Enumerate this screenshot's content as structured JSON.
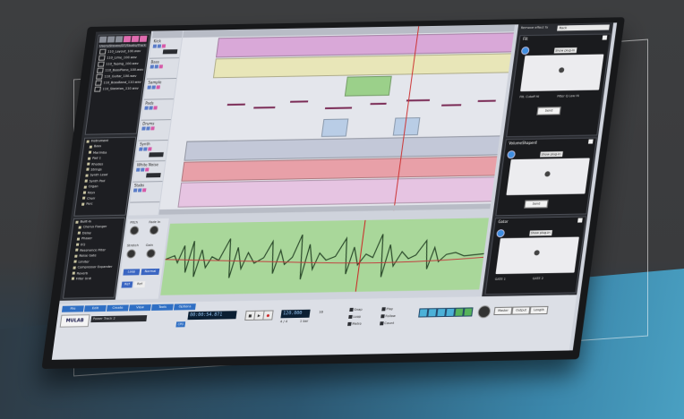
{
  "file_browser": {
    "path": "Users/Steven/DT/Studio/Track",
    "items": [
      "110_Layout_100.wav",
      "110_Lime_100.wav",
      "110_Typing_100.wav",
      "110_BassPiano_100.wav",
      "110_Guitar_100.wav",
      "110_BossBand_110.wav",
      "110_Skeleton_110.wav"
    ]
  },
  "instruments": {
    "header": "Instrument",
    "items": [
      "Bass",
      "Marimba",
      "Pad 1",
      "Rhodes",
      "Strings",
      "Synth Lead",
      "Synth Pad",
      "Organ",
      "Keys",
      "Choir",
      "Perc"
    ]
  },
  "effects": {
    "header": "Built-in",
    "items": [
      "Chorus Flanger",
      "Delay",
      "Phaser",
      "EQ",
      "Resonance Filter",
      "Noise Gate",
      "Limiter",
      "Compressor Expander",
      "Reverb",
      "Filter Unit"
    ]
  },
  "tracks": [
    {
      "name": "Kick",
      "preset": "Drumkit"
    },
    {
      "name": "Bass",
      "preset": ""
    },
    {
      "name": "Sample",
      "preset": ""
    },
    {
      "name": "Pads",
      "preset": ""
    },
    {
      "name": "Drums",
      "preset": ""
    },
    {
      "name": "Synth",
      "preset": "Drumkit"
    },
    {
      "name": "White Noise",
      "preset": "Noise"
    },
    {
      "name": "Stabs",
      "preset": ""
    }
  ],
  "editor": {
    "pitch_label": "Pitch",
    "fade_in_label": "Fade In",
    "stretch_label": "Stretch",
    "gain_label": "Gain",
    "btn_left": "Loop",
    "btn_right": "Normal",
    "mode1": "Ref",
    "mode2": "Ref"
  },
  "effects_rack": {
    "header_label": "Remove effect fx",
    "header_dropdown": "Rack",
    "units": [
      {
        "name": "Filt",
        "preset": "Show plug-in",
        "param1": "Filt. Cutoff Hi",
        "param2": "Filter Q Low Hi",
        "action": "Send"
      },
      {
        "name": "VolumeShaper4",
        "preset": "Show plug-in",
        "action": "Send"
      },
      {
        "name": "Gator",
        "preset": "Show plug-in",
        "param1": "GATE 1",
        "param2": "GATE 2"
      }
    ]
  },
  "transport": {
    "menu": [
      "File",
      "Edit",
      "Create",
      "View",
      "Tools",
      "Options"
    ],
    "logo": "MULAB",
    "time": "00:00:54.871",
    "tempo": "120.000",
    "signature": "4 / 4",
    "bars": "1 bar",
    "quantize": "16",
    "checks": [
      "Snap",
      "Loop",
      "Metro",
      "Play",
      "Follow",
      "Count"
    ],
    "project": "Power Track 2",
    "cpu": "CPU",
    "mix_labels": [
      "Master",
      "Output",
      "Length"
    ]
  },
  "colors": {
    "accent": "#2f6fc4",
    "clip_pink": "#d9a8d8",
    "clip_yellow": "#e8e6b8",
    "clip_red": "#e8a0a8",
    "clip_blue": "#b9cde6",
    "wave_green": "#a9d79a"
  }
}
